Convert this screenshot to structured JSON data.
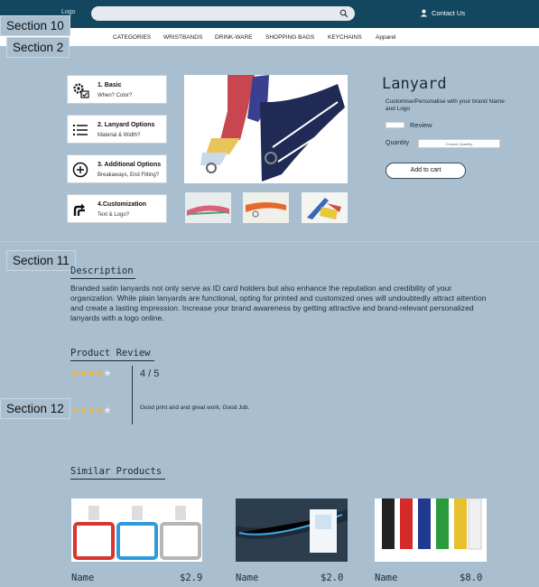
{
  "header": {
    "logo_text": "Logo",
    "search_placeholder": "",
    "contact_label": "Contact Us"
  },
  "nav": [
    "CATEGORIES",
    "WRISTBANDS",
    "DRINK-WARE",
    "SHOPPING BAGS",
    "KEYCHAINS",
    "Apparel"
  ],
  "section_labels": {
    "s10": "Section 10",
    "s2": "Section 2",
    "s11": "Section 11",
    "s12": "Section 12"
  },
  "options": [
    {
      "title": "1. Basic",
      "subtitle": "When? Color?",
      "icon": "gear-card-icon"
    },
    {
      "title": "2. Lanyard Options",
      "subtitle": "Material & Width?",
      "icon": "list-icon"
    },
    {
      "title": "3. Additional Options",
      "subtitle": "Breakaways, End Fitting?",
      "icon": "plus-circle-icon"
    },
    {
      "title": "4.Customization",
      "subtitle": "Text & Logo?",
      "icon": "route-icon"
    }
  ],
  "product": {
    "title": "Lanyard",
    "subtitle": "Customise/Personalise with your brand Name and Logo",
    "review_label": "Review",
    "quantity_label": "Quantity",
    "quantity_placeholder": "Choose Quantity",
    "cart_label": "Add to cart"
  },
  "description": {
    "heading": "Description",
    "text": "Branded satin lanyards not only serve as ID card holders but also enhance the reputation and credibility of your organization. While plain lanyards are functional, opting for printed and customized ones will undoubtedly attract attention and create a lasting impression. Increase your brand awareness by getting attractive and brand-relevant personalized lanyards with a logo online."
  },
  "reviews": {
    "heading": "Product Review",
    "rating_text": "4 / 5",
    "rating_value": 4,
    "max_rating": 5,
    "comment": "Good print and and great work, Good Job.",
    "comment_rating": 4
  },
  "similar": {
    "heading": "Similar Products",
    "items": [
      {
        "name": "Name",
        "price": "$2.9"
      },
      {
        "name": "Name",
        "price": "$2.0"
      },
      {
        "name": "Name",
        "price": "$8.0"
      }
    ]
  },
  "colors": {
    "header_bg": "#12475f",
    "page_bg": "#a9bfd0",
    "star": "#f2b233"
  }
}
